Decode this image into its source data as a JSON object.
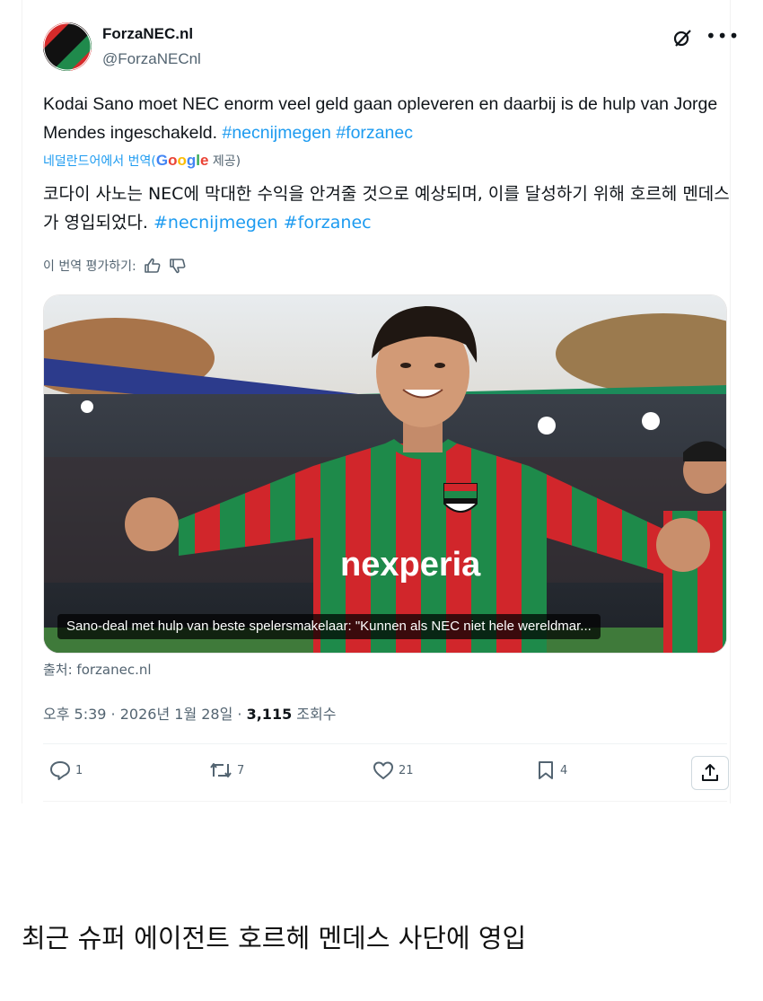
{
  "account": {
    "name": "ForzaNEC.nl",
    "handle": "@ForzaNECnl"
  },
  "tweet": {
    "text_nl": "Kodai Sano moet NEC enorm veel geld gaan opleveren en daarbij is de hulp van Jorge Mendes ingeschakeld.",
    "hashtag1": "#necnijmegen",
    "hashtag2": "#forzanec",
    "translated_prefix": "네덜란드어에서 번역(",
    "google": "Google",
    "provided_suffix": " 제공)",
    "text_ko": "코다이 사노는 NEC에 막대한 수익을 안겨줄 것으로 예상되며, 이를 달성하기 위해 호르헤 멘데스가 영입되었다.",
    "rate_label": "이 번역 평가하기:"
  },
  "media": {
    "caption": "Sano-deal met hulp van beste spelersmakelaar: \"Kunnen als NEC niet hele wereldmar...",
    "jersey_text": "nexperia",
    "source": "출처: forzanec.nl"
  },
  "meta": {
    "time": "오후 5:39",
    "sep": " · ",
    "date": "2026년 1월 28일",
    "views": "3,115",
    "views_label": "조회수"
  },
  "stats": {
    "replies": "1",
    "reposts": "7",
    "likes": "21",
    "bookmarks": "4"
  },
  "icons": {
    "reply": "reply-icon",
    "repost": "repost-icon",
    "like": "heart-icon",
    "bookmark": "bookmark-icon",
    "share": "share-icon",
    "grok": "grok-icon",
    "more": "more-icon"
  },
  "colors": {
    "link": "#1d9bf0",
    "secondary": "#536471",
    "nec_red": "#d62a2a",
    "nec_green": "#1f8a4c"
  },
  "footer": {
    "caption_ko": "최근 슈퍼 에이전트 호르헤 멘데스 사단에 영입"
  }
}
